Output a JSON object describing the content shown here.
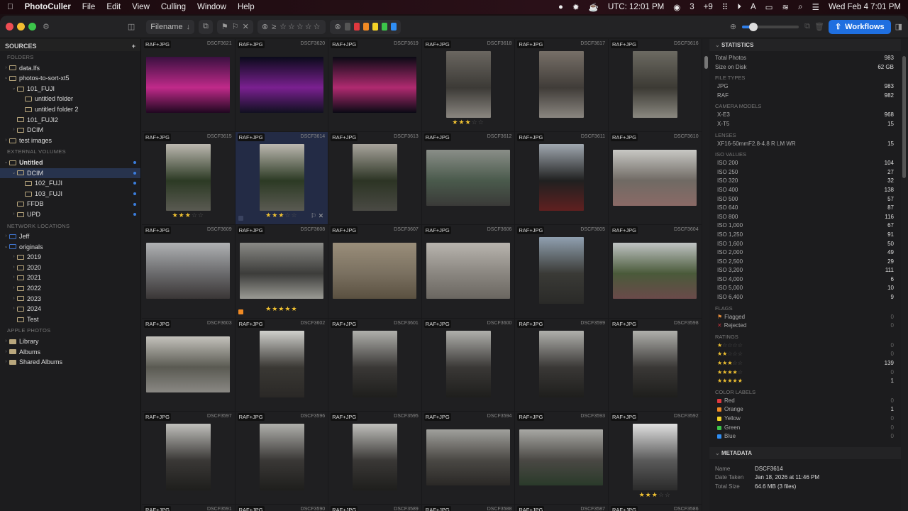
{
  "menubar": {
    "app": "PhotoCuller",
    "items": [
      "File",
      "Edit",
      "View",
      "Culling",
      "Window",
      "Help"
    ],
    "clock_utc": "UTC: 12:01 PM",
    "count": "3",
    "plus": "+9",
    "datetime": "Wed Feb 4  7:01 PM"
  },
  "toolbar": {
    "sort_label": "Filename",
    "workflows_label": "Workflows",
    "color_swatches": [
      "#555555",
      "#e0383e",
      "#f08a24",
      "#f5d327",
      "#3cc54a",
      "#2f8ef4"
    ]
  },
  "sidebar": {
    "title": "SOURCES",
    "sections": [
      {
        "label": "FOLDERS",
        "items": [
          {
            "label": "data.lfs",
            "depth": 0,
            "caret": "›"
          },
          {
            "label": "photos-to-sort-xt5",
            "depth": 0,
            "caret": "⌄"
          },
          {
            "label": "101_FUJI",
            "depth": 1,
            "caret": "⌄"
          },
          {
            "label": "untitled folder",
            "depth": 2,
            "caret": ""
          },
          {
            "label": "untitled folder 2",
            "depth": 2,
            "caret": ""
          },
          {
            "label": "101_FUJI2",
            "depth": 1,
            "caret": ""
          },
          {
            "label": "DCIM",
            "depth": 1,
            "caret": "›"
          },
          {
            "label": "test images",
            "depth": 0,
            "caret": "›"
          }
        ]
      },
      {
        "label": "EXTERNAL VOLUMES",
        "items": [
          {
            "label": "Untitled",
            "depth": 0,
            "caret": "⌄",
            "dot": true,
            "bold": true
          },
          {
            "label": "DCIM",
            "depth": 1,
            "caret": "⌄",
            "dot": true,
            "selected": true
          },
          {
            "label": "102_FUJI",
            "depth": 2,
            "caret": "",
            "dot": true
          },
          {
            "label": "103_FUJI",
            "depth": 2,
            "caret": "",
            "dot": true
          },
          {
            "label": "FFDB",
            "depth": 1,
            "caret": "",
            "dot": true
          },
          {
            "label": "UPD",
            "depth": 1,
            "caret": "›",
            "dot": true
          }
        ]
      },
      {
        "label": "NETWORK LOCATIONS",
        "items": [
          {
            "label": "Jeff",
            "depth": 0,
            "caret": "›",
            "net": true
          },
          {
            "label": "originals",
            "depth": 0,
            "caret": "⌄",
            "net": true
          },
          {
            "label": "2019",
            "depth": 1,
            "caret": "›"
          },
          {
            "label": "2020",
            "depth": 1,
            "caret": "›"
          },
          {
            "label": "2021",
            "depth": 1,
            "caret": "›"
          },
          {
            "label": "2022",
            "depth": 1,
            "caret": "›"
          },
          {
            "label": "2023",
            "depth": 1,
            "caret": "›"
          },
          {
            "label": "2024",
            "depth": 1,
            "caret": "›"
          },
          {
            "label": "Test",
            "depth": 1,
            "caret": ""
          }
        ]
      },
      {
        "label": "APPLE PHOTOS",
        "items": [
          {
            "label": "Library",
            "depth": 0,
            "caret": "›",
            "fill": true
          },
          {
            "label": "Albums",
            "depth": 0,
            "caret": "›",
            "fill": true
          },
          {
            "label": "Shared Albums",
            "depth": 0,
            "caret": "›",
            "fill": true
          }
        ]
      }
    ]
  },
  "grid": {
    "badge": "RAF+JPG",
    "photos": [
      {
        "name": "DSCF3621",
        "o": "L",
        "c": "#3a1040,#c02a8a,#200820"
      },
      {
        "name": "DSCF3620",
        "o": "L",
        "c": "#0a0a1a,#7a2090,#101020"
      },
      {
        "name": "DSCF3619",
        "o": "L",
        "c": "#0a0a14,#b02a70,#0a0a14"
      },
      {
        "name": "DSCF3618",
        "o": "P",
        "c": "#6a6660,#3c3a36,#8a8680",
        "rating": 3
      },
      {
        "name": "DSCF3617",
        "o": "P",
        "c": "#777068,#403c38,#8a8680"
      },
      {
        "name": "DSCF3616",
        "o": "P",
        "c": "#6c6a62,#3c3a34,#8a8880"
      },
      {
        "name": "DSCF3615",
        "o": "P",
        "c": "#bcb8b0,#2c3a24,#5a5a52",
        "rating": 3
      },
      {
        "name": "DSCF3614",
        "o": "P",
        "c": "#bcb8b0,#2c3a24,#5a5a52",
        "rating": 3,
        "selected": true
      },
      {
        "name": "DSCF3613",
        "o": "P",
        "c": "#a8a49c,#2c3424,#4a4a44"
      },
      {
        "name": "DSCF3612",
        "o": "L",
        "c": "#8a8e88,#4a5a4c,#3a3a38"
      },
      {
        "name": "DSCF3611",
        "o": "P",
        "c": "#a0a8b0,#202020,#602020"
      },
      {
        "name": "DSCF3610",
        "o": "L",
        "c": "#c8c8c4,#706a64,#8a6a66"
      },
      {
        "name": "DSCF3609",
        "o": "L",
        "c": "#b0b2b4,#6a6a6c,#3a3636"
      },
      {
        "name": "DSCF3608",
        "o": "L",
        "c": "#8a8a86,#3c3c3a,#9a9a94",
        "rating": 5,
        "label": "#f08a24"
      },
      {
        "name": "DSCF3607",
        "o": "L",
        "c": "#9a8e7a,#7a7060,#5a5040"
      },
      {
        "name": "DSCF3606",
        "o": "L",
        "c": "#b8b4ae,#8a8680,#6a6660"
      },
      {
        "name": "DSCF3605",
        "o": "P",
        "c": "#90a0b0,#3a3a36,#2a2a28"
      },
      {
        "name": "DSCF3604",
        "o": "L",
        "c": "#c0c4c4,#4a5a3a,#6a4a4a"
      },
      {
        "name": "DSCF3603",
        "o": "L",
        "c": "#c4c2bc,#5a5a52,#8a8884"
      },
      {
        "name": "DSCF3602",
        "o": "P",
        "c": "#d0d0cc,#3a3834,#2a2826"
      },
      {
        "name": "DSCF3601",
        "o": "P",
        "c": "#b0b0ac,#3a3836,#1e1e1c"
      },
      {
        "name": "DSCF3600",
        "o": "P",
        "c": "#b0b0ac,#3a3836,#1e1e1c"
      },
      {
        "name": "DSCF3599",
        "o": "P",
        "c": "#b0b0ac,#3a3836,#1e1e1c"
      },
      {
        "name": "DSCF3598",
        "o": "P",
        "c": "#b0b0ac,#3a3836,#1e1e1c"
      },
      {
        "name": "DSCF3597",
        "o": "P",
        "c": "#c0c0bc,#3a3836,#1e1e1c"
      },
      {
        "name": "DSCF3596",
        "o": "P",
        "c": "#b0b0ac,#3a3836,#1e1e1c"
      },
      {
        "name": "DSCF3595",
        "o": "P",
        "c": "#c0c0bc,#3a3836,#1e1e1c"
      },
      {
        "name": "DSCF3594",
        "o": "L",
        "c": "#a0a09c,#4a4844,#2a2826"
      },
      {
        "name": "DSCF3593",
        "o": "L",
        "c": "#a8a8a4,#4a4844,#2a3a2a"
      },
      {
        "name": "DSCF3592",
        "o": "P",
        "c": "#e0e0e0,#5a5a5a,#2a2a2a",
        "rating": 3
      },
      {
        "name": "DSCF3591",
        "o": "L",
        "c": "#333,#333,#333"
      },
      {
        "name": "DSCF3590",
        "o": "L",
        "c": "#333,#333,#333"
      },
      {
        "name": "DSCF3589",
        "o": "L",
        "c": "#333,#333,#333"
      },
      {
        "name": "DSCF3588",
        "o": "L",
        "c": "#333,#333,#333"
      },
      {
        "name": "DSCF3587",
        "o": "L",
        "c": "#333,#333,#333"
      },
      {
        "name": "DSCF3586",
        "o": "L",
        "c": "#333,#333,#333"
      }
    ]
  },
  "statistics": {
    "title": "STATISTICS",
    "totals": [
      {
        "k": "Total Photos",
        "v": "983"
      },
      {
        "k": "Size on Disk",
        "v": "62 GB"
      }
    ],
    "groups": [
      {
        "label": "FILE TYPES",
        "rows": [
          {
            "k": "JPG",
            "v": "983"
          },
          {
            "k": "RAF",
            "v": "982"
          }
        ]
      },
      {
        "label": "CAMERA MODELS",
        "rows": [
          {
            "k": "X-E3",
            "v": "968"
          },
          {
            "k": "X-T5",
            "v": "15"
          }
        ]
      },
      {
        "label": "LENSES",
        "rows": [
          {
            "k": "XF16-50mmF2.8-4.8 R LM WR",
            "v": "15"
          }
        ]
      },
      {
        "label": "ISO VALUES",
        "rows": [
          {
            "k": "ISO 200",
            "v": "104"
          },
          {
            "k": "ISO 250",
            "v": "27"
          },
          {
            "k": "ISO 320",
            "v": "32"
          },
          {
            "k": "ISO 400",
            "v": "138"
          },
          {
            "k": "ISO 500",
            "v": "57"
          },
          {
            "k": "ISO 640",
            "v": "87"
          },
          {
            "k": "ISO 800",
            "v": "116"
          },
          {
            "k": "ISO 1,000",
            "v": "67"
          },
          {
            "k": "ISO 1,250",
            "v": "91"
          },
          {
            "k": "ISO 1,600",
            "v": "50"
          },
          {
            "k": "ISO 2,000",
            "v": "49"
          },
          {
            "k": "ISO 2,500",
            "v": "29"
          },
          {
            "k": "ISO 3,200",
            "v": "111"
          },
          {
            "k": "ISO 4,000",
            "v": "6"
          },
          {
            "k": "ISO 5,000",
            "v": "10"
          },
          {
            "k": "ISO 6,400",
            "v": "9"
          }
        ]
      }
    ],
    "flags": {
      "label": "FLAGS",
      "rows": [
        {
          "k": "Flagged",
          "v": "0",
          "icon": "⚑",
          "color": "#e08a3a"
        },
        {
          "k": "Rejected",
          "v": "0",
          "icon": "✕",
          "color": "#c0303a"
        }
      ]
    },
    "ratings": {
      "label": "RATINGS",
      "rows": [
        {
          "stars": 1,
          "v": "0"
        },
        {
          "stars": 2,
          "v": "0"
        },
        {
          "stars": 3,
          "v": "139"
        },
        {
          "stars": 4,
          "v": "0"
        },
        {
          "stars": 5,
          "v": "1"
        }
      ]
    },
    "colors": {
      "label": "COLOR LABELS",
      "rows": [
        {
          "k": "Red",
          "v": "0",
          "color": "#e0383e"
        },
        {
          "k": "Orange",
          "v": "1",
          "color": "#f08a24"
        },
        {
          "k": "Yellow",
          "v": "0",
          "color": "#f5d327"
        },
        {
          "k": "Green",
          "v": "0",
          "color": "#3cc54a"
        },
        {
          "k": "Blue",
          "v": "0",
          "color": "#2f8ef4"
        }
      ]
    }
  },
  "metadata": {
    "title": "METADATA",
    "rows": [
      {
        "k": "Name",
        "v": "DSCF3614"
      },
      {
        "k": "Date Taken",
        "v": "Jan 18, 2026 at 11:46 PM"
      },
      {
        "k": "Total Size",
        "v": "64.6 MB (3 files)"
      }
    ]
  }
}
